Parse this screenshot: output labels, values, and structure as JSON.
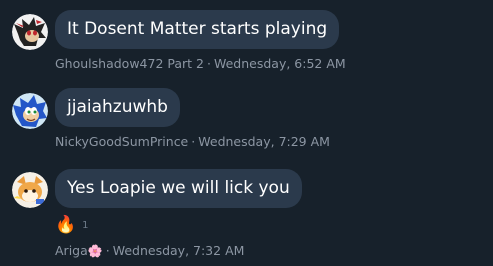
{
  "messages": [
    {
      "text": "It Dosent Matter starts playing",
      "author": "Ghoulshadow472 Part 2",
      "separator": "·",
      "time": "Wednesday, 6:52 AM",
      "avatar_icon": "shadow-hedgehog-avatar"
    },
    {
      "text": "jjaiahzuwhb",
      "author": "NickyGoodSumPrince",
      "separator": "·",
      "time": "Wednesday, 7:29 AM",
      "avatar_icon": "sonic-avatar"
    },
    {
      "text": "Yes Loapie we will lick you",
      "author": "Ariga",
      "author_suffix_icon": "cherry-blossom-icon",
      "author_suffix_glyph": "🌸",
      "separator": "·",
      "time": "Wednesday, 7:32 AM",
      "avatar_icon": "fox-avatar",
      "reaction": {
        "icon": "fire-icon",
        "glyph": "🔥",
        "count": "1"
      }
    }
  ],
  "colors": {
    "background": "#17212b",
    "bubble": "#2b3a4c",
    "meta_text": "#8c96a3",
    "message_text": "#ffffff"
  }
}
